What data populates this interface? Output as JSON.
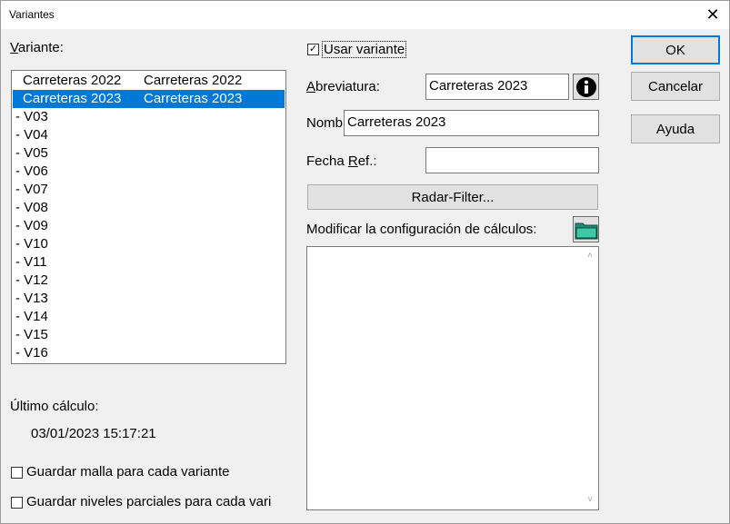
{
  "window": {
    "title": "Variantes",
    "close_glyph": "✕"
  },
  "variant_label": "Variante:",
  "variants": [
    {
      "col1": "Carreteras 2022",
      "col2": "Carreteras 2022",
      "selected": false
    },
    {
      "col1": "Carreteras 2023",
      "col2": "Carreteras 2023",
      "selected": true
    },
    {
      "col1": "- V03",
      "col2": "",
      "selected": false
    },
    {
      "col1": "- V04",
      "col2": "",
      "selected": false
    },
    {
      "col1": "- V05",
      "col2": "",
      "selected": false
    },
    {
      "col1": "- V06",
      "col2": "",
      "selected": false
    },
    {
      "col1": "- V07",
      "col2": "",
      "selected": false
    },
    {
      "col1": "- V08",
      "col2": "",
      "selected": false
    },
    {
      "col1": "- V09",
      "col2": "",
      "selected": false
    },
    {
      "col1": "- V10",
      "col2": "",
      "selected": false
    },
    {
      "col1": "- V11",
      "col2": "",
      "selected": false
    },
    {
      "col1": "- V12",
      "col2": "",
      "selected": false
    },
    {
      "col1": "- V13",
      "col2": "",
      "selected": false
    },
    {
      "col1": "- V14",
      "col2": "",
      "selected": false
    },
    {
      "col1": "- V15",
      "col2": "",
      "selected": false
    },
    {
      "col1": "- V16",
      "col2": "",
      "selected": false
    }
  ],
  "last_calc": {
    "label": "Último cálculo:",
    "value": "03/01/2023  15:17:21"
  },
  "options": {
    "save_mesh": {
      "label": "Guardar malla para cada variante",
      "checked": false
    },
    "save_levels": {
      "label": "Guardar niveles parciales para cada vari",
      "checked": false
    }
  },
  "use_variant": {
    "label": "Usar variante",
    "checked": true,
    "check_glyph": "✓"
  },
  "fields": {
    "abbreviation": {
      "label_prefix": "",
      "label_underlined": "A",
      "label_rest": "breviatura:",
      "value": "Carreteras 2023"
    },
    "name": {
      "label": "Nomb",
      "value": "Carreteras 2023"
    },
    "ref_date": {
      "label_prefix": "Fecha ",
      "label_underlined": "R",
      "label_rest": "ef.:",
      "value": ""
    }
  },
  "radar_button": "Radar-Filter...",
  "calc_config_label": "Modificar la configuración de cálculos:",
  "buttons": {
    "ok": "OK",
    "cancel": "Cancelar",
    "help": "Ayuda"
  },
  "icons": {
    "info": "info-icon",
    "folder": "folder-icon"
  }
}
